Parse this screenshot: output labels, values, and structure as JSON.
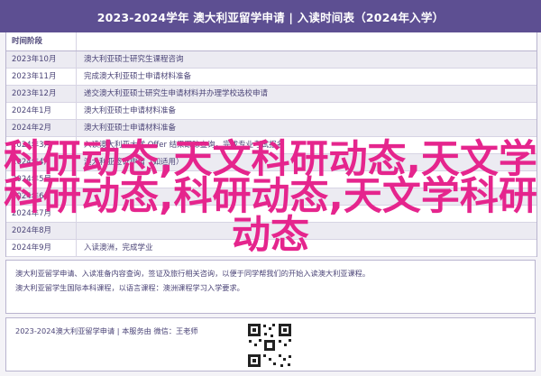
{
  "header": {
    "title": "2023-2024学年 澳大利亚留学申请 | 入读时间表（2024年入学）"
  },
  "table": {
    "head_col1": "时间阶段",
    "head_col2": "",
    "rows": [
      {
        "time": "2023年10月",
        "task": "澳大利亚硕士研究生课程咨询",
        "style": "alt"
      },
      {
        "time": "2023年11月",
        "task": "完成澳大利亚硕士申请材料准备",
        "style": "white"
      },
      {
        "time": "2023年12月",
        "task": "递交澳大利亚硕士研究生申请材料并办理学校选校申请",
        "style": "alt"
      },
      {
        "time": "2024年1月",
        "task": "澳大利亚硕士申请材料准备",
        "style": "white"
      },
      {
        "time": "2024年2月",
        "task": "澳大利亚硕士申请材料准备",
        "style": "alt"
      },
      {
        "time": "2024年3月",
        "task": "入读澳大利亚大学 Offer 结果跟踪查询，完成专业考试报名",
        "style": "white"
      },
      {
        "time": "2024年4月",
        "task": "澳大利亚签证申请（如适用）",
        "style": "alt"
      },
      {
        "time": "2024年5月",
        "task": "",
        "style": "white"
      },
      {
        "time": "2024年6月",
        "task": "",
        "style": "alt"
      },
      {
        "time": "2024年7月",
        "task": "",
        "style": "white"
      },
      {
        "time": "2024年8月",
        "task": "",
        "style": "alt"
      },
      {
        "time": "2024年9月",
        "task": "入读澳洲，完成学业",
        "style": "white"
      }
    ]
  },
  "notes": {
    "line1": "澳大利亚留学申请、入读准备内容查询，签证及旅行相关咨询，以便于同学帮我们的开始入读澳大利亚课程。",
    "line2": "澳大利亚留学生国际本科课程，以语言课程：澳洲课程学习入学要求。"
  },
  "contact": {
    "text": "2023-2024澳大利亚留学申请 | 本服务由 微信：王老师"
  },
  "overlay": {
    "line1": "科研动态,天文科研动态,天文学",
    "line2": "科研动态,科研动态,天文学科研",
    "line3": "动态"
  },
  "colors": {
    "header_bg": "#5d4f92",
    "text": "#4b4477",
    "overlay": "#e5258d"
  },
  "icons": {
    "qr": "qr-code-icon"
  }
}
